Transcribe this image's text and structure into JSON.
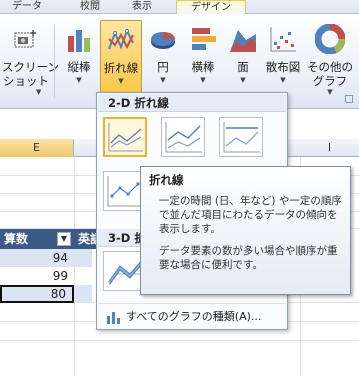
{
  "tabs": [
    {
      "label": "データ"
    },
    {
      "label": "校閲"
    },
    {
      "label": "表示"
    },
    {
      "label": "デザイン"
    }
  ],
  "ribbon": {
    "screenshot": {
      "line1": "スクリーン",
      "line2": "ショット"
    },
    "buttons": [
      {
        "label": "縦棒"
      },
      {
        "label": "折れ線"
      },
      {
        "label": "円"
      },
      {
        "label": "横棒"
      },
      {
        "label": "面"
      },
      {
        "label": "散布図"
      },
      {
        "label": "その他の",
        "label2": "グラフ"
      }
    ]
  },
  "sheet": {
    "col_e": "E",
    "col_i": "I",
    "header1": "算数",
    "header2": "英語",
    "values": [
      "94",
      "99",
      "80"
    ]
  },
  "menu": {
    "section_2d": "2-D 折れ線",
    "section_3d": "3-D 折",
    "all_types": "すべてのグラフの種類(A)..."
  },
  "tooltip": {
    "title": "折れ線",
    "para1": "一定の時間 (日、年など) や一定の順序で並んだ項目にわたるデータの傾向を表示します。",
    "para2": "データ要素の数が多い場合や順序が重要な場合に便利です。"
  },
  "colors": {
    "accent_selected": "#fbd46d",
    "table_header": "#3c5a86",
    "band": "#dbe4f2"
  }
}
